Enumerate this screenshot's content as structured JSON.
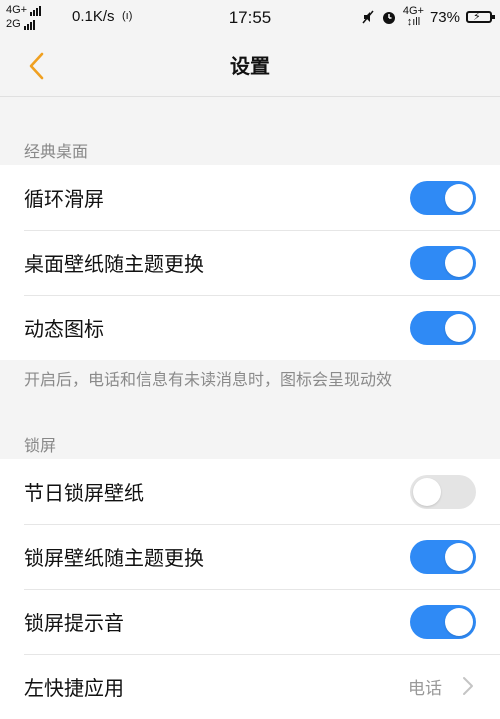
{
  "status_bar": {
    "net_top": "4G+",
    "net_bottom": "2G",
    "speed": "0.1K/s",
    "time": "17:55",
    "right_net": "4G+",
    "battery": "73%"
  },
  "header": {
    "title": "设置"
  },
  "sections": [
    {
      "label": "经典桌面",
      "items": [
        {
          "label": "循环滑屏",
          "toggle": true
        },
        {
          "label": "桌面壁纸随主题更换",
          "toggle": true
        },
        {
          "label": "动态图标",
          "toggle": true
        }
      ],
      "hint": "开启后，电话和信息有未读消息时，图标会呈现动效"
    },
    {
      "label": "锁屏",
      "items": [
        {
          "label": "节日锁屏壁纸",
          "toggle": false
        },
        {
          "label": "锁屏壁纸随主题更换",
          "toggle": true
        },
        {
          "label": "锁屏提示音",
          "toggle": true
        },
        {
          "label": "左快捷应用",
          "value": "电话"
        }
      ]
    }
  ],
  "colors": {
    "accent": "#2f8af5",
    "back_arrow": "#f0a020",
    "toggle_off": "#e4e4e4"
  },
  "icons": {
    "back": "chevron-left-icon",
    "more": "chevron-right-icon"
  }
}
